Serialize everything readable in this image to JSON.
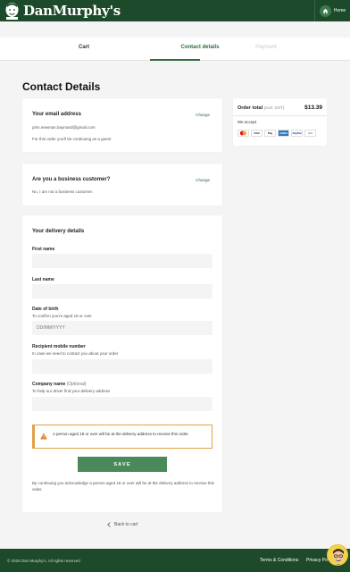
{
  "header": {
    "brand": "DanMurphy's",
    "home_label": "Home"
  },
  "stepper": {
    "cart": "Cart",
    "contact": "Contact details",
    "payment": "Payment"
  },
  "page_title": "Contact Details",
  "email_card": {
    "heading": "Your email address",
    "change": "Change",
    "email": "john.newman.baymard@gmail.com",
    "guest_note": "For this order you'll be continuing as a guest"
  },
  "business_card": {
    "heading": "Are you a business customer?",
    "change": "Change",
    "answer": "No, I am not a business customer."
  },
  "delivery": {
    "heading": "Your delivery details",
    "first_name_label": "First name",
    "last_name_label": "Last name",
    "dob_label": "Date of birth",
    "dob_hint": "To confirm you're aged 18 or over",
    "dob_placeholder": "DD/MM/YYYY",
    "mobile_label": "Recipient mobile number",
    "mobile_hint": "In case we need to contact you about your order",
    "company_label": "Company name",
    "company_optional": "(Optional)",
    "company_hint": "To help our driver find your delivery address",
    "notice": "A person aged 18 or over will be at the delivery address to receive this order.",
    "save": "SAVE",
    "disclaimer": "By continuing you acknowledge a person aged 18 or over will be at the delivery address to receive this order."
  },
  "summary": {
    "label": "Order total",
    "excl": "(excl. GST)",
    "total": "$13.39",
    "accept": "We accept",
    "payment_methods": [
      "MC",
      "VISA",
      "Pay",
      "AMEX",
      "PayPal",
      "Gift"
    ]
  },
  "back_link": "Back to cart",
  "footer": {
    "copyright": "© 2025 Dan Murphy's. All rights reserved",
    "terms": "Terms & Conditions",
    "privacy": "Privacy Po"
  },
  "colors": {
    "brand_green": "#1d4a2a",
    "accent_green": "#2e6b3c",
    "button_green": "#4a8a5a",
    "warning": "#e0a14a"
  }
}
